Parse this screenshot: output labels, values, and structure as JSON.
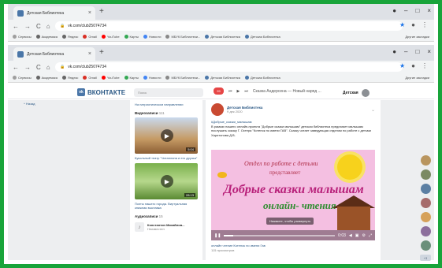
{
  "browser": {
    "tab_title": "Детская Библиотека",
    "url": "vk.com/club25074734",
    "bookmarks": [
      "Сервисы",
      "Академика",
      "Яндекс",
      "Gmail",
      "YouTube",
      "Карты",
      "Новости",
      "МБУК Библиотеки...",
      "Детская Библиотека",
      "Детская Библиотека"
    ],
    "other_bookmarks": "Другие закладки"
  },
  "vk": {
    "logo": "ВКОНТАКТЕ",
    "search_placeholder": "Поиск",
    "player_track": "Сказка Андерсена — Новый наряд ...",
    "user_name": "Детская",
    "left_back": "Назад"
  },
  "sidebar": {
    "top_text": "На патриотическом направлении",
    "videos_label": "Видеозаписи",
    "videos_count": "111",
    "video1_title": "Кукольный театр \"Читаплана и его друзья\"",
    "video1_dur": "5:04",
    "video2_title": "Поэты нашего города. Виртуальная книжная выставка",
    "video2_dur": "28:13",
    "audio_label": "Аудиозаписи",
    "audio_count": "15",
    "audio_artist": "Константин Михайлов...",
    "audio_title": "Неизвестен"
  },
  "post": {
    "author": "Детская Библиотека",
    "date": "9 дек 2020",
    "hashtag": "#Добрые_сказки_малышам",
    "text": "В рамках нашего онлайн-проекта \"Добрые сказки малышам\" детская библиотека предлагает малышам послушать сказку Г. Остера \"Котенок по имени ГАВ\". Сказку читает заведующая отделом по работе с детьми Харитонова Д.В.",
    "video_title1": "Отдел по работе с детьми",
    "video_title2": "представляет",
    "video_title3": "Добрые сказки малышам",
    "video_title4": "онлайн- чтения",
    "hint": "Нажмите, чтобы развернуть",
    "time": "0:03",
    "caption": "онлайн чтение Котенок по имени Гав",
    "views": "115 просмотров"
  },
  "rightbar": {
    "badge": "+3"
  }
}
